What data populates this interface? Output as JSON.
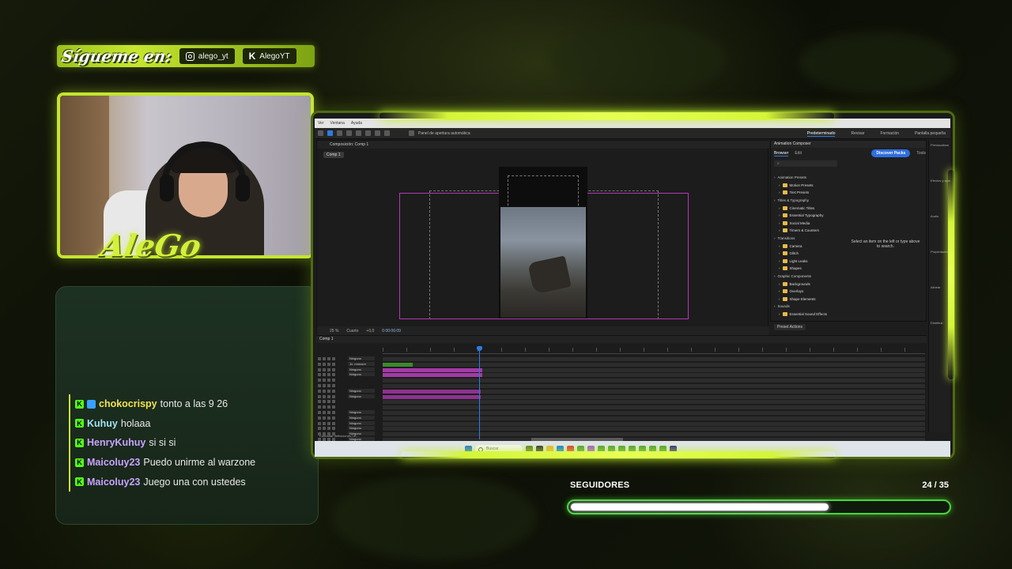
{
  "overlay": {
    "follow_label": "Sígueme en:",
    "instagram_handle": "alego_yt",
    "kick_handle": "AlegoYT",
    "brand_logo": "AleGo"
  },
  "chat": {
    "messages": [
      {
        "user": "chokocrispy",
        "text": "tonto a las 9 26",
        "color": "#f2e34a",
        "badge": true
      },
      {
        "user": "Kuhuy",
        "text": "holaaa",
        "color": "#9fe3ef",
        "badge": false
      },
      {
        "user": "HenryKuhuy",
        "text": "si si si",
        "color": "#c7a3ff",
        "badge": false
      },
      {
        "user": "Maicoluy23",
        "text": "Puedo unirme al warzone",
        "color": "#c7a3ff",
        "badge": false
      },
      {
        "user": "Maicoluy23",
        "text": "Juego una con ustedes",
        "color": "#c7a3ff",
        "badge": false
      }
    ]
  },
  "followers": {
    "label": "SEGUIDORES",
    "count_text": "24 / 35",
    "current": 24,
    "goal": 35
  },
  "app": {
    "menu": [
      "Ver",
      "Ventana",
      "Ayuda"
    ],
    "toolbar_option": "Panel de apertura automática",
    "workspaces": [
      "Predeterminado",
      "Revisar",
      "Formación",
      "Pantalla pequeña"
    ],
    "comp_tab": "Composición: Comp 1",
    "comp_subtab": "Comp 1",
    "viewer": {
      "zoom": "25 %",
      "resolution": "Cuarto",
      "exposure": "+0,0",
      "timecode": "0:00:06:09"
    },
    "animation_composer": {
      "title": "Animation Composer",
      "tabs": [
        "Browser",
        "Edit"
      ],
      "tools_label": "Tools",
      "discover_button": "Discover Packs",
      "hint": "Select an item on the left or type above to search.",
      "preset_actions": "Preset Actions",
      "tree": [
        {
          "label": "Animation Presets",
          "level": 0
        },
        {
          "label": "Motion Presets",
          "level": 1
        },
        {
          "label": "Text Presets",
          "level": 1
        },
        {
          "label": "Titles & Typography",
          "level": 0
        },
        {
          "label": "Cinematic Titles",
          "level": 1
        },
        {
          "label": "Essential Typography",
          "level": 1
        },
        {
          "label": "Social Media",
          "level": 1
        },
        {
          "label": "Timers & Counters",
          "level": 1
        },
        {
          "label": "Transitions",
          "level": 0
        },
        {
          "label": "Camera",
          "level": 1
        },
        {
          "label": "Glitch",
          "level": 1
        },
        {
          "label": "Light Leaks",
          "level": 1
        },
        {
          "label": "Shapes",
          "level": 1
        },
        {
          "label": "Graphic Components",
          "level": 0
        },
        {
          "label": "Backgrounds",
          "level": 1
        },
        {
          "label": "Overlays",
          "level": 1
        },
        {
          "label": "Shape Elements",
          "level": 1
        },
        {
          "label": "Sounds",
          "level": 0
        },
        {
          "label": "Essential Sound Effects",
          "level": 1
        }
      ]
    },
    "right_column": [
      "Previsualizar",
      "Efectos y ajustes",
      "Audio",
      "Propiedades",
      "Alinear",
      "Distribuir"
    ],
    "timeline": {
      "tab": "Comp 1",
      "layer_selects": [
        "Ninguno",
        "11. mmcore",
        "Ninguno",
        "Ninguno",
        "Ninguno",
        "Ninguno"
      ],
      "footer": "Conmutar definiciones / m..."
    },
    "taskbar_search": "Buscar"
  }
}
